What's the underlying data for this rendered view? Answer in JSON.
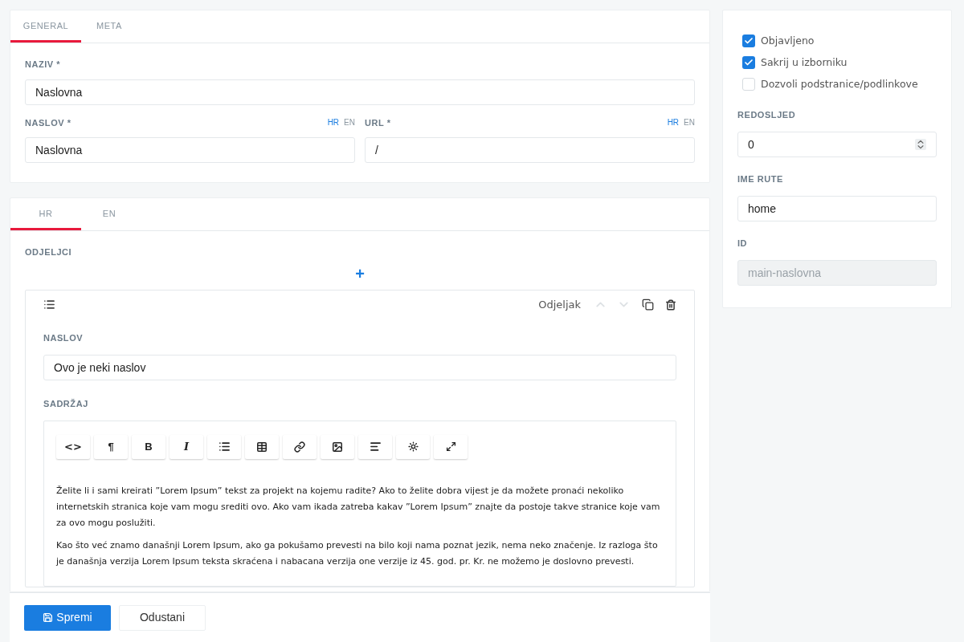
{
  "main_tabs": [
    {
      "label": "GENERAL",
      "selected": true
    },
    {
      "label": "META",
      "selected": false
    }
  ],
  "naziv": {
    "label": "NAZIV *",
    "value": "Naslovna"
  },
  "naslov": {
    "label": "NASLOV *",
    "langs": [
      {
        "label": "HR",
        "selected": true
      },
      {
        "label": "EN",
        "selected": false
      }
    ],
    "value": "Naslovna"
  },
  "url": {
    "label": "URL *",
    "langs": [
      {
        "label": "HR",
        "selected": true
      },
      {
        "label": "EN",
        "selected": false
      }
    ],
    "value": "/"
  },
  "content_tabs": [
    {
      "label": "HR",
      "selected": true
    },
    {
      "label": "EN",
      "selected": false
    }
  ],
  "sections_label": "ODJELJCI",
  "add_button": "+",
  "section": {
    "type_label": "Odjeljak",
    "move_up": {
      "disabled": true
    },
    "move_down": {
      "disabled": true
    },
    "title": {
      "label": "NASLOV",
      "value": "Ovo je neki naslov"
    },
    "content_label": "SADRŽAJ",
    "toolbar": [
      {
        "kind": "code",
        "label": "<>"
      },
      {
        "kind": "paragraph",
        "label": "¶"
      },
      {
        "kind": "bold",
        "label": "B"
      },
      {
        "kind": "italic",
        "label": "I"
      },
      {
        "kind": "list"
      },
      {
        "kind": "table"
      },
      {
        "kind": "link"
      },
      {
        "kind": "image"
      },
      {
        "kind": "align"
      },
      {
        "kind": "special"
      },
      {
        "kind": "fullscreen"
      }
    ],
    "paragraphs": [
      "Želite li i sami kreirati ”Lorem Ipsum” tekst za projekt na kojemu radite? Ako to želite dobra vijest je da možete pronaći nekoliko internetskih stranica koje vam mogu srediti ovo. Ako vam ikada zatreba kakav ”Lorem Ipsum” znajte da postoje takve stranice koje vam za ovo mogu poslužiti.",
      "Kao što već znamo današnji Lorem Ipsum, ako ga pokušamo prevesti na bilo koji nama poznat jezik, nema neko značenje. Iz razloga što je današnja verzija Lorem Ipsum teksta skraćena i nabacana verzija one verzije iz 45. god. pr. Kr. ne možemo je doslovno prevesti."
    ]
  },
  "footer": {
    "save": "Spremi",
    "cancel": "Odustani"
  },
  "sidebar": {
    "checkboxes": [
      {
        "label": "Objavljeno",
        "checked": true
      },
      {
        "label": "Sakrij u izborniku",
        "checked": true
      },
      {
        "label": "Dozvoli podstranice/podlinkove",
        "checked": false
      }
    ],
    "order": {
      "label": "REDOSLJED",
      "value": "0"
    },
    "route": {
      "label": "IME RUTE",
      "value": "home"
    },
    "id": {
      "label": "ID",
      "value": "main-naslovna",
      "disabled": true
    }
  }
}
